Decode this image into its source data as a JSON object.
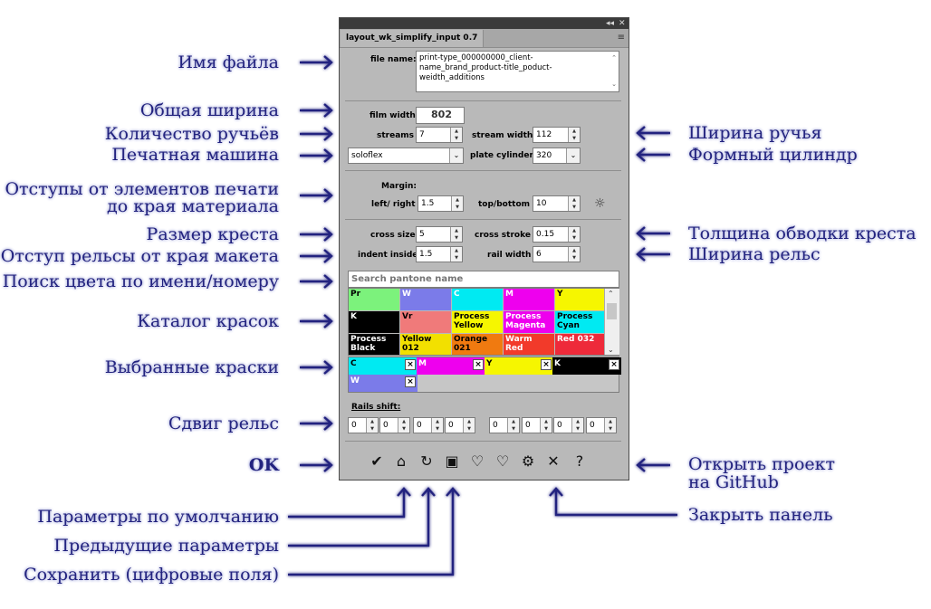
{
  "panel": {
    "tab_title": "layout_wk_simplify_input 0.7",
    "file_name_label": "file name:",
    "file_name_value": "print-type_000000000_client-name_brand_product-title_poduct-weidth_additions",
    "film_width_label": "film width",
    "film_width_value": "802",
    "streams_label": "streams",
    "streams_value": "7",
    "stream_width_label": "stream width",
    "stream_width_value": "112",
    "press_value": "soloflex",
    "plate_cylinder_label": "plate cylinder",
    "plate_cylinder_value": "320",
    "margin_label": "Margin:",
    "left_right_label": "left/ right",
    "left_right_value": "1.5",
    "top_bottom_label": "top/bottom",
    "top_bottom_value": "10",
    "cross_size_label": "cross size",
    "cross_size_value": "5",
    "cross_stroke_label": "cross stroke",
    "cross_stroke_value": "0.15",
    "indent_inside_label": "indent inside",
    "indent_inside_value": "1.5",
    "rail_width_label": "rail width",
    "rail_width_value": "6",
    "search_placeholder": "Search pantone name",
    "swatches": [
      {
        "name": "Pr",
        "color": "#7cf27c",
        "text": "#000"
      },
      {
        "name": "W",
        "color": "#7b7be9",
        "text": "#fff"
      },
      {
        "name": "C",
        "color": "#00eaf2",
        "text": "#fff"
      },
      {
        "name": "M",
        "color": "#ee00ee",
        "text": "#fff"
      },
      {
        "name": "Y",
        "color": "#f6f600",
        "text": "#000"
      },
      {
        "name": "K",
        "color": "#000000",
        "text": "#fff"
      },
      {
        "name": "Vr",
        "color": "#f07a7a",
        "text": "#000"
      },
      {
        "name": "Process Yellow",
        "color": "#f6f600",
        "text": "#000"
      },
      {
        "name": "Process Magenta",
        "color": "#ee00ee",
        "text": "#fff"
      },
      {
        "name": "Process Cyan",
        "color": "#00eaf2",
        "text": "#000"
      },
      {
        "name": "Process Black",
        "color": "#000000",
        "text": "#fff"
      },
      {
        "name": "Yellow 012",
        "color": "#f2e000",
        "text": "#000"
      },
      {
        "name": "Orange 021",
        "color": "#f07a10",
        "text": "#000"
      },
      {
        "name": "Warm Red",
        "color": "#f23a2a",
        "text": "#fff"
      },
      {
        "name": "Red 032",
        "color": "#ee2a3a",
        "text": "#fff"
      }
    ],
    "selected": [
      {
        "name": "C",
        "color": "#00eaf2",
        "text": "#000"
      },
      {
        "name": "M",
        "color": "#ee00ee",
        "text": "#fff"
      },
      {
        "name": "Y",
        "color": "#f6f600",
        "text": "#000"
      },
      {
        "name": "K",
        "color": "#000000",
        "text": "#fff"
      },
      {
        "name": "W",
        "color": "#7b7be9",
        "text": "#fff"
      }
    ],
    "remove_symbol": "×",
    "rails_shift_label": "Rails shift:",
    "rails_shift_values": [
      "0",
      "0",
      "0",
      "0",
      "0",
      "0",
      "0",
      "0"
    ],
    "toolbar": [
      {
        "name": "ok-icon",
        "glyph": "✔"
      },
      {
        "name": "home-icon",
        "glyph": "⌂"
      },
      {
        "name": "refresh-icon",
        "glyph": "↻"
      },
      {
        "name": "save-icon",
        "glyph": "▣"
      },
      {
        "name": "heart-plus-icon",
        "glyph": "♡"
      },
      {
        "name": "heart-icon",
        "glyph": "♡"
      },
      {
        "name": "gear-icon",
        "glyph": "⚙"
      },
      {
        "name": "close-icon",
        "glyph": "✕"
      },
      {
        "name": "help-icon",
        "glyph": "?"
      }
    ]
  },
  "annotations": {
    "file_name": "Имя файла",
    "total_width": "Общая ширина",
    "streams_count": "Количество ручьёв",
    "press": "Печатная машина",
    "margins_line1": "Отступы от элементов печати",
    "margins_line2": "до края материала",
    "cross_size": "Размер креста",
    "rail_indent": "Отступ рельсы от края макета",
    "color_search": "Поиск цвета по имени/номеру",
    "ink_catalog": "Каталог красок",
    "selected_inks": "Выбранные краски",
    "rail_shift": "Сдвиг рельс",
    "ok": "OK",
    "defaults": "Параметры по умолчанию",
    "previous": "Предыдущие параметры",
    "save": "Сохранить (цифровые поля)",
    "stream_width": "Ширина ручья",
    "plate_cylinder": "Формный цилиндр",
    "cross_stroke": "Толщина обводки креста",
    "rail_width": "Ширина рельс",
    "github_line1": "Открыть проект",
    "github_line2": "на GitHub",
    "close_panel": "Закрыть панель"
  },
  "colors": {
    "annotation": "#23237f",
    "arrow": "#23237f",
    "panel_bg": "#b9b9b9"
  }
}
